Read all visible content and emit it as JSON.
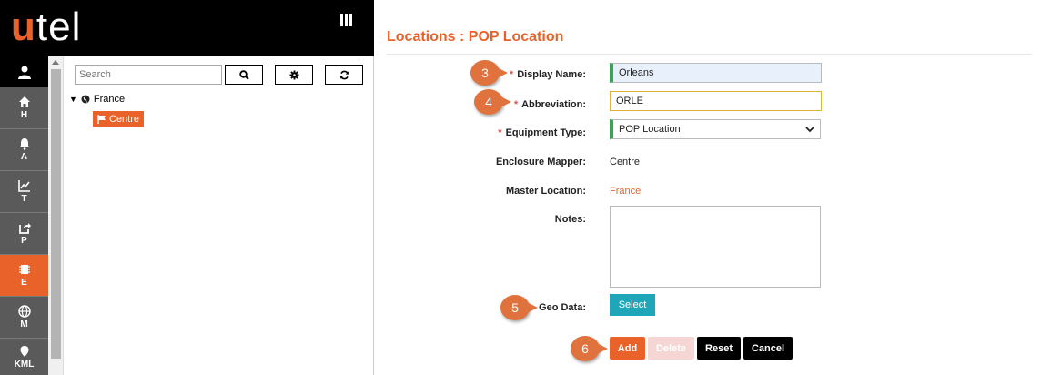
{
  "brand": {
    "logo_accent": "u",
    "logo_rest": "tel"
  },
  "nav": {
    "items": [
      {
        "icon": "home-icon",
        "label": "H"
      },
      {
        "icon": "bell-icon",
        "label": "A"
      },
      {
        "icon": "chart-icon",
        "label": "T"
      },
      {
        "icon": "share-icon",
        "label": "P"
      },
      {
        "icon": "chip-icon",
        "label": "E",
        "active": true
      },
      {
        "icon": "globe-icon",
        "label": "M"
      },
      {
        "icon": "map-pin-icon",
        "label": "KML"
      }
    ]
  },
  "tree": {
    "search_placeholder": "Search",
    "root_label": "France",
    "child_label": "Centre"
  },
  "form": {
    "title": "Locations : POP Location",
    "display_name_label": "Display Name:",
    "display_name_value": "Orleans",
    "abbreviation_label": "Abbreviation:",
    "abbreviation_value": "ORLE",
    "equipment_type_label": "Equipment Type:",
    "equipment_type_value": "POP Location",
    "enclosure_mapper_label": "Enclosure Mapper:",
    "enclosure_mapper_value": "Centre",
    "master_location_label": "Master Location:",
    "master_location_value": "France",
    "notes_label": "Notes:",
    "geo_data_label": "Geo Data:",
    "select_label": "Select",
    "required_marker": "*"
  },
  "actions": {
    "add": "Add",
    "delete": "Delete",
    "reset": "Reset",
    "cancel": "Cancel"
  },
  "callouts": {
    "c3": "3",
    "c4": "4",
    "c5": "5",
    "c6": "6"
  },
  "colors": {
    "accent": "#e8622a",
    "teal": "#1fa6b8",
    "required_bar": "#3aa655"
  }
}
